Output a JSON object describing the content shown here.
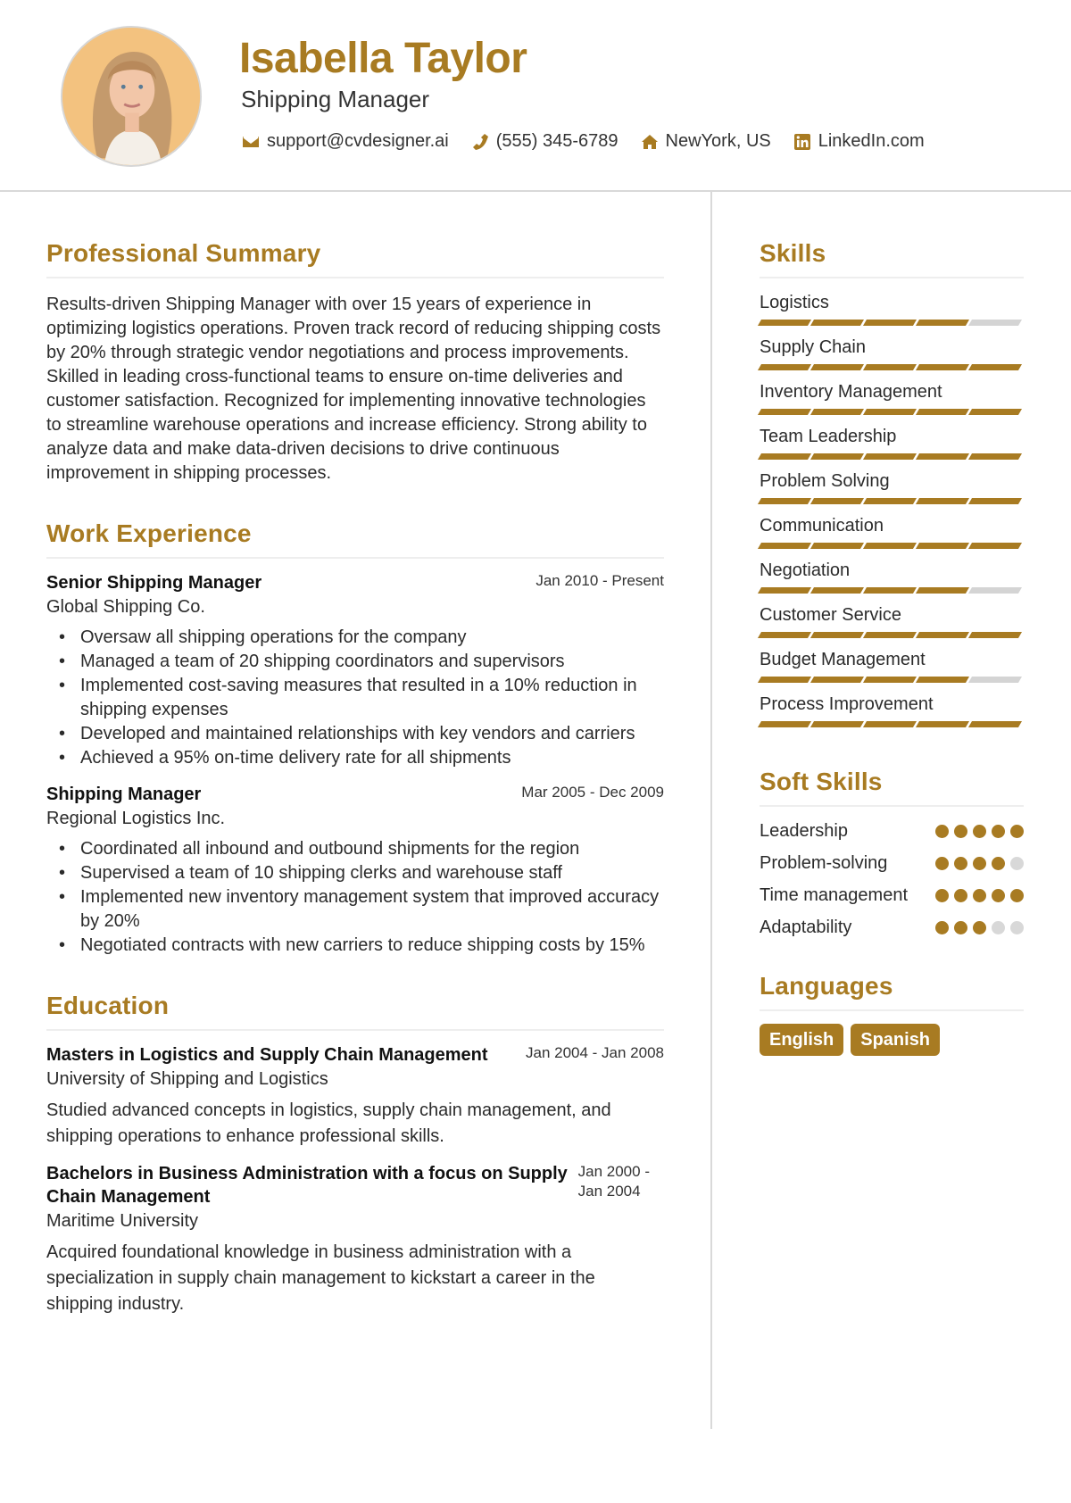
{
  "header": {
    "name": "Isabella Taylor",
    "title": "Shipping Manager",
    "photo_alt": "profile-photo",
    "contacts": [
      {
        "icon": "envelope-icon",
        "text": "support@cvdesigner.ai"
      },
      {
        "icon": "phone-icon",
        "text": "(555) 345-6789"
      },
      {
        "icon": "home-icon",
        "text": "NewYork, US"
      },
      {
        "icon": "linkedin-icon",
        "text": "LinkedIn.com"
      }
    ]
  },
  "colors": {
    "accent": "#a87b22",
    "inactive": "#d4d4d4",
    "text": "#2b2b2b"
  },
  "summary": {
    "heading": "Professional Summary",
    "text": "Results-driven Shipping Manager with over 15 years of experience in optimizing logistics operations. Proven track record of reducing shipping costs by 20% through strategic vendor negotiations and process improvements. Skilled in leading cross-functional teams to ensure on-time deliveries and customer satisfaction. Recognized for implementing innovative technologies to streamline warehouse operations and increase efficiency. Strong ability to analyze data and make data-driven decisions to drive continuous improvement in shipping processes."
  },
  "work": {
    "heading": "Work Experience",
    "entries": [
      {
        "role": "Senior Shipping Manager",
        "date": "Jan 2010 - Present",
        "org": "Global Shipping Co.",
        "bullets": [
          "Oversaw all shipping operations for the company",
          "Managed a team of 20 shipping coordinators and supervisors",
          "Implemented cost-saving measures that resulted in a 10% reduction in shipping expenses",
          "Developed and maintained relationships with key vendors and carriers",
          "Achieved a 95% on-time delivery rate for all shipments"
        ]
      },
      {
        "role": "Shipping Manager",
        "date": "Mar 2005 - Dec 2009",
        "org": "Regional Logistics Inc.",
        "bullets": [
          "Coordinated all inbound and outbound shipments for the region",
          "Supervised a team of 10 shipping clerks and warehouse staff",
          "Implemented new inventory management system that improved accuracy by 20%",
          "Negotiated contracts with new carriers to reduce shipping costs by 15%"
        ]
      }
    ]
  },
  "education": {
    "heading": "Education",
    "entries": [
      {
        "degree": "Masters in Logistics and Supply Chain Management",
        "date": "Jan 2004 - Jan 2008",
        "school": "University of Shipping and Logistics",
        "desc": "Studied advanced concepts in logistics, supply chain management, and shipping operations to enhance professional skills."
      },
      {
        "degree": "Bachelors in Business Administration with a focus on Supply Chain Management",
        "date": "Jan 2000 - Jan 2004",
        "school": "Maritime University",
        "desc": "Acquired foundational knowledge in business administration with a specialization in supply chain management to kickstart a career in the shipping industry."
      }
    ]
  },
  "skills": {
    "heading": "Skills",
    "max": 5,
    "items": [
      {
        "name": "Logistics",
        "level": 4
      },
      {
        "name": "Supply Chain",
        "level": 5
      },
      {
        "name": "Inventory Management",
        "level": 5
      },
      {
        "name": "Team Leadership",
        "level": 5
      },
      {
        "name": "Problem Solving",
        "level": 5
      },
      {
        "name": "Communication",
        "level": 5
      },
      {
        "name": "Negotiation",
        "level": 4
      },
      {
        "name": "Customer Service",
        "level": 5
      },
      {
        "name": "Budget Management",
        "level": 4
      },
      {
        "name": "Process Improvement",
        "level": 5
      }
    ]
  },
  "soft_skills": {
    "heading": "Soft Skills",
    "max": 5,
    "items": [
      {
        "name": "Leadership",
        "level": 5
      },
      {
        "name": "Problem-solving",
        "level": 4
      },
      {
        "name": "Time management",
        "level": 5
      },
      {
        "name": "Adaptability",
        "level": 3
      }
    ]
  },
  "languages": {
    "heading": "Languages",
    "items": [
      "English",
      "Spanish"
    ]
  }
}
